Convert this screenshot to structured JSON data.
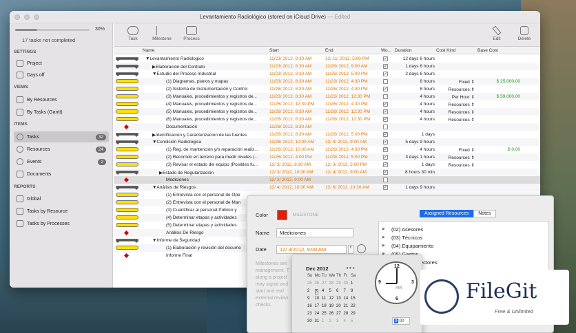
{
  "window": {
    "title": "Levantamiento Radiológico (stored on iCloud Drive)",
    "edited": " — Edited"
  },
  "sidebar": {
    "progress_fraction": 0.3,
    "progress_pct": "30%",
    "tasks_not_completed": "17 tasks not completed",
    "settings_header": "SETTINGS",
    "settings": [
      {
        "label": "Project"
      },
      {
        "label": "Days off"
      }
    ],
    "views_header": "VIEWS",
    "views": [
      {
        "label": "By Resources"
      },
      {
        "label": "By Tasks (Gantt)"
      }
    ],
    "items_header": "ITEMS",
    "items": [
      {
        "label": "Tasks",
        "badge": "32"
      },
      {
        "label": "Resources",
        "badge": "24"
      },
      {
        "label": "Events",
        "badge": "2"
      },
      {
        "label": "Documents",
        "badge": ""
      }
    ],
    "reports_header": "REPORTS",
    "reports": [
      {
        "label": "Global"
      },
      {
        "label": "Tasks by Resource"
      },
      {
        "label": "Tasks by Processes"
      }
    ]
  },
  "toolbar": {
    "task": "Task",
    "milestone": "Milestone",
    "process": "Process",
    "edit": "Edit",
    "delete": "Delete"
  },
  "columns": {
    "name": "Name",
    "start": "Start",
    "end": "End",
    "work": "Wo...",
    "duration": "Duration",
    "cost_kind": "Cost Kind",
    "base_cost": "Base Cost"
  },
  "rows": [
    {
      "type": "sum",
      "name": "▼Levantamiento Radiologico",
      "indent": 0,
      "start": "11/23/ 2012,   8:30 AM",
      "end": "12/ 11/ 2012,   5:00 PM",
      "check": "✓",
      "dur": "12 days 6 hours",
      "ck": "",
      "cost": ""
    },
    {
      "type": "sum",
      "name": "▶Elaboración del Contrato",
      "indent": 1,
      "start": "11/23/ 2012,   8:30 AM",
      "end": "11/26/ 2012,   9:00 AM",
      "check": "✓",
      "dur": "1 days 6 hours",
      "ck": "",
      "cost": ""
    },
    {
      "type": "sum",
      "name": "▼Estudio del Proceso Industrial",
      "indent": 1,
      "start": "11/23/ 2012,   8:30 AM",
      "end": "11/26/ 2012,   5:00 PM",
      "check": "✓",
      "dur": "2 days 6 hours",
      "ck": "",
      "cost": ""
    },
    {
      "type": "task",
      "name": "(1) Diagramas, planos y mapas",
      "indent": 2,
      "start": "11/23/ 2012,   8:30 AM",
      "end": "11/23/ 2012,   4:30 PM",
      "check": "",
      "dur": "8 hours",
      "ck": "Fixed",
      "cost": "$ 25,000.00"
    },
    {
      "type": "task",
      "name": "(2) Sistema de Instrumentación y Control",
      "indent": 2,
      "start": "11/26/ 2012,   8:30 AM",
      "end": "11/26/ 2012,   4:30 PM",
      "check": "✓",
      "dur": "8 hours",
      "ck": "Resources",
      "cost": ""
    },
    {
      "type": "task",
      "name": "(3) Manuales, procedimientos y registros de...",
      "indent": 2,
      "start": "11/23/ 2012,   8:30 AM",
      "end": "11/23/ 2012,   12:30 PM",
      "check": "",
      "dur": "4 hours",
      "ck": "Per Hour",
      "cost": "$ 59,000.00"
    },
    {
      "type": "task",
      "name": "(4) Manuales, procedimientos y registros de...",
      "indent": 2,
      "start": "11/26/ 2012,   12:30 PM",
      "end": "11/26/ 2012,   4:30 PM",
      "check": "✓",
      "dur": "4 hours",
      "ck": "Resources",
      "cost": ""
    },
    {
      "type": "task",
      "name": "(5) Manuales, procedimientos y registros de...",
      "indent": 2,
      "start": "11/26/ 2012,   8:30 AM",
      "end": "11/26/ 2012,   12:30 PM",
      "check": "✓",
      "dur": "4 hours",
      "ck": "Resources",
      "cost": ""
    },
    {
      "type": "task",
      "name": "(6) Manuales, procedimientos y registros de...",
      "indent": 2,
      "start": "11/26/ 2012,   8:30 AM",
      "end": "11/26/ 2012,   12:30 PM",
      "check": "✓",
      "dur": "4 hours",
      "ck": "Resources",
      "cost": ""
    },
    {
      "type": "ms",
      "name": "Documentación",
      "indent": 2,
      "start": "11/26/ 2012,   8:30 AM",
      "end": "",
      "check": "",
      "dur": "",
      "ck": "",
      "cost": ""
    },
    {
      "type": "sum",
      "name": "▶Identificacion y Caracterizacion de las fuentes",
      "indent": 1,
      "start": "11/26/ 2012,   8:30 AM",
      "end": "11/26/ 2012,   5:00 PM",
      "check": "✓",
      "dur": "1 days",
      "ck": "",
      "cost": ""
    },
    {
      "type": "sum",
      "name": "▼Condición Radiológica",
      "indent": 1,
      "start": "11/26/ 2012,   10:00 AM",
      "end": "12/  4/ 2012,   9:00 AM",
      "check": "✓",
      "dur": "5 days 9 hours",
      "ck": "",
      "cost": ""
    },
    {
      "type": "task",
      "name": "(1) Reg. de mantención y/o reparación realiz...",
      "indent": 2,
      "start": "11/26/ 2012,   10:00 AM",
      "end": "11/26/ 2012,   4:30 PM",
      "check": "✓",
      "dur": "4 hours",
      "ck": "Fixed",
      "cost": "$ 0.00"
    },
    {
      "type": "task",
      "name": "(2) Recorrido en terreno para medir niveles (...",
      "indent": 2,
      "start": "11/26/ 2012,   4:00 PM",
      "end": "11/29/ 2012,   5:00 PM",
      "check": "✓",
      "dur": "3 days 1 hours",
      "ck": "Resources",
      "cost": ""
    },
    {
      "type": "task",
      "name": "(3) Revisar el estado del equipo (Posibles fu...",
      "indent": 2,
      "start": "12/  3/ 2012,   8:30 AM",
      "end": "12/  3/ 2012,   5:00 PM",
      "check": "✓",
      "dur": "1 days",
      "ck": "Resources",
      "cost": ""
    },
    {
      "type": "sum",
      "name": "▶Estado de Regularización",
      "indent": 2,
      "start": "12/  3/ 2012,   10:30 AM",
      "end": "12/  4/ 2012,   9:00 AM",
      "check": "✓",
      "dur": "8 hours 30 min",
      "ck": "",
      "cost": ""
    },
    {
      "type": "ms",
      "name": "Mediciones",
      "indent": 2,
      "start": "12/  3/ 2012,   9:00 AM",
      "end": "",
      "check": "",
      "dur": "",
      "ck": "",
      "cost": "",
      "selected": true
    },
    {
      "type": "sum",
      "name": "▼Análisis de Riesgos",
      "indent": 1,
      "start": "12/  4/ 2012,   10:30 AM",
      "end": "12/  6/ 2012,   10:30 AM",
      "check": "✓",
      "dur": "1 days 9 hours",
      "ck": "",
      "cost": ""
    },
    {
      "type": "task",
      "name": "(1) Entrevista con el personal de Ope",
      "indent": 2,
      "start": "",
      "end": "",
      "check": "",
      "dur": "",
      "ck": "",
      "cost": ""
    },
    {
      "type": "task",
      "name": "(2) Entrevista con el personal de Man",
      "indent": 2,
      "start": "",
      "end": "",
      "check": "",
      "dur": "",
      "ck": "",
      "cost": ""
    },
    {
      "type": "task",
      "name": "(3) Cuantificar al personal Público y",
      "indent": 2,
      "start": "",
      "end": "",
      "check": "",
      "dur": "",
      "ck": "",
      "cost": ""
    },
    {
      "type": "task",
      "name": "(4) Determinar etapas y actividades",
      "indent": 2,
      "start": "",
      "end": "",
      "check": "",
      "dur": "",
      "ck": "",
      "cost": ""
    },
    {
      "type": "task",
      "name": "(5) Determinar etapas y actividades",
      "indent": 2,
      "start": "",
      "end": "",
      "check": "",
      "dur": "",
      "ck": "",
      "cost": ""
    },
    {
      "type": "ms",
      "name": "Análisis De Riesgo",
      "indent": 2,
      "start": "",
      "end": "",
      "check": "",
      "dur": "",
      "ck": "",
      "cost": ""
    },
    {
      "type": "sum",
      "name": "▼Informe de Seguridad",
      "indent": 1,
      "start": "",
      "end": "",
      "check": "",
      "dur": "",
      "ck": "",
      "cost": ""
    },
    {
      "type": "task",
      "name": "(1) Elaboración y revisión del docume",
      "indent": 2,
      "start": "",
      "end": "",
      "check": "",
      "dur": "",
      "ck": "",
      "cost": ""
    },
    {
      "type": "ms",
      "name": "Informe Final",
      "indent": 2,
      "start": "",
      "end": "",
      "check": "",
      "dur": "",
      "ck": "",
      "cost": ""
    }
  ],
  "inspector": {
    "color_label": "Color",
    "milestone_tag": "MILESTONE",
    "name_label": "Name",
    "name_value": "Mediciones",
    "date_label": "Date",
    "date_value": "12/  3/2012,   9:00 AM",
    "help": "Milestones are\nmanagement. T\nalong a project\nmay signal and\nstart and end\nexternal review\nchecks.",
    "tab_assigned": "Assigned Resources",
    "tab_notes": "Notes",
    "resources": [
      "(02) Asesores",
      "(03) Técnicos",
      "(04) Equipamiento",
      "(05) Gastos",
      "ectores"
    ],
    "accent": "#1e6de8",
    "milestone_color": "#e02000"
  },
  "calendar": {
    "month": "Dec 2012",
    "weekdays": [
      "Su",
      "Mo",
      "Tu",
      "We",
      "Th",
      "Fr",
      "Sa"
    ],
    "weeks": [
      [
        "25",
        "26",
        "27",
        "28",
        "29",
        "30",
        "1"
      ],
      [
        "2",
        "3",
        "4",
        "5",
        "6",
        "7",
        "8"
      ],
      [
        "9",
        "10",
        "11",
        "12",
        "13",
        "14",
        "15"
      ],
      [
        "16",
        "17",
        "18",
        "19",
        "20",
        "21",
        "22"
      ],
      [
        "23",
        "24",
        "25",
        "26",
        "27",
        "28",
        "29"
      ],
      [
        "30",
        "31",
        "1",
        "2",
        "3",
        "4",
        "5"
      ]
    ],
    "am": "AM",
    "time_hour": "9",
    "time_min": "00",
    "clock_numbers": [
      "12",
      "3",
      "6",
      "9"
    ]
  },
  "watermark": {
    "name": "FileGit",
    "tagline": "Free & Unlimited"
  }
}
